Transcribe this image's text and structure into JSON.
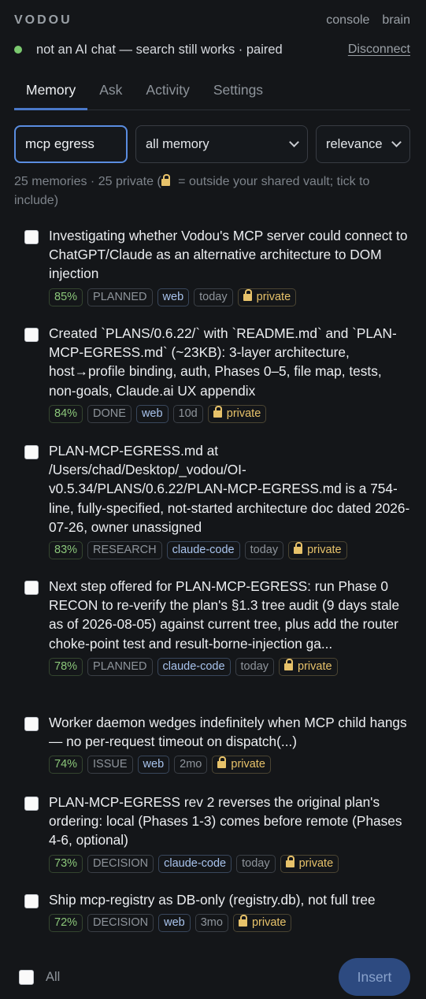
{
  "header": {
    "brand": "VODOU",
    "links": [
      "console",
      "brain"
    ]
  },
  "status": {
    "text": "not an AI chat — search still works · paired",
    "indicator_color": "#7bc96f",
    "disconnect_label": "Disconnect"
  },
  "tabs": [
    {
      "label": "Memory",
      "active": true
    },
    {
      "label": "Ask",
      "active": false
    },
    {
      "label": "Activity",
      "active": false
    },
    {
      "label": "Settings",
      "active": false
    }
  ],
  "controls": {
    "search_value": "mcp egress",
    "scope_selected": "all memory",
    "sort_selected": "relevance"
  },
  "summary": {
    "text_before_icon": "25 memories · 25 private (",
    "text_after_icon": " = outside your shared vault; tick to include)"
  },
  "items": [
    {
      "text": "Investigating whether Vodou's MCP server could connect to ChatGPT/Claude as an alternative architecture to DOM injection",
      "score": "85%",
      "type": "PLANNED",
      "source": "web",
      "age": "today",
      "visibility": "private"
    },
    {
      "text": "Created `PLANS/0.6.22/` with `README.md` and `PLAN-MCP-EGRESS.md` (~23KB): 3-layer architecture, host→profile binding, auth, Phases 0–5, file map, tests, non-goals, Claude.ai UX appendix",
      "score": "84%",
      "type": "DONE",
      "source": "web",
      "age": "10d",
      "visibility": "private"
    },
    {
      "text": "PLAN-MCP-EGRESS.md at /Users/chad/Desktop/_vodou/OI-v0.5.34/PLANS/0.6.22/PLAN-MCP-EGRESS.md is a 754-line, fully-specified, not-started architecture doc dated 2026-07-26, owner unassigned",
      "score": "83%",
      "type": "RESEARCH",
      "source": "claude-code",
      "age": "today",
      "visibility": "private"
    },
    {
      "text": "Next step offered for PLAN-MCP-EGRESS: run Phase 0 RECON to re-verify the plan's §1.3 tree audit (9 days stale as of 2026-08-05) against current tree, plus add the router choke-point test and result-borne-injection ga...",
      "score": "78%",
      "type": "PLANNED",
      "source": "claude-code",
      "age": "today",
      "visibility": "private"
    },
    {
      "text": "Worker daemon wedges indefinitely when MCP child hangs — no per-request timeout on dispatch(...)",
      "score": "74%",
      "type": "ISSUE",
      "source": "web",
      "age": "2mo",
      "visibility": "private"
    },
    {
      "text": "PLAN-MCP-EGRESS rev 2 reverses the original plan's ordering: local (Phases 1-3) comes before remote (Phases 4-6, optional)",
      "score": "73%",
      "type": "DECISION",
      "source": "claude-code",
      "age": "today",
      "visibility": "private"
    },
    {
      "text": "Ship mcp-registry as DB-only (registry.db), not full tree",
      "score": "72%",
      "type": "DECISION",
      "source": "web",
      "age": "3mo",
      "visibility": "private"
    }
  ],
  "footer": {
    "all_label": "All",
    "insert_label": "Insert"
  },
  "colors": {
    "background": "#141619",
    "accent": "#4a78c8",
    "score_green": "#8bc77a",
    "private_gold": "#e7c26a"
  }
}
